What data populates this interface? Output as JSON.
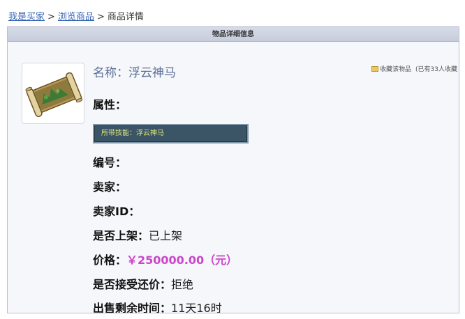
{
  "breadcrumb": {
    "items": [
      "我是买家",
      "浏览商品"
    ],
    "separator": ">",
    "current": "商品详情"
  },
  "panel": {
    "title": "物品详细信息"
  },
  "item": {
    "name_label": "名称：",
    "name_value": "浮云神马",
    "attr_label": "属性：",
    "skill_text": "所带技能：浮云神马",
    "id_label": "编号：",
    "seller_label": "卖家：",
    "seller_id_label": "卖家ID：",
    "listed_label": "是否上架：",
    "listed_value": "已上架",
    "price_label": "价格：",
    "price_value": "￥250000.00（元）",
    "counter_label": "是否接受还价：",
    "counter_value": "拒绝",
    "time_label": "出售剩余时间：",
    "time_value": "11天16时"
  },
  "favorite": {
    "link_text": "收藏该物品",
    "count_text": "(已有33人收藏"
  },
  "icons": {
    "thumbnail": "scroll-item-icon",
    "favorite": "folder-icon"
  },
  "colors": {
    "link": "#3563b4",
    "name": "#5a6f96",
    "price": "#cc44cc",
    "skill_box_bg": "#3b5566",
    "skill_text": "#e0e87a",
    "titlebar": "#c7ccdd"
  }
}
